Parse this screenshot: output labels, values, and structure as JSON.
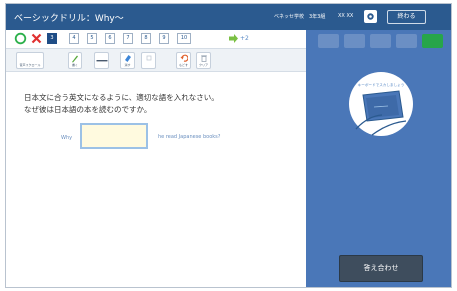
{
  "header": {
    "title": "ベーシックドリル：Why〜",
    "school": "ベネッセ学校",
    "class_info": "3年3組",
    "user": "XX XX",
    "exit_label": "終わる"
  },
  "question_nav": {
    "numbers": [
      "3",
      "4",
      "5",
      "6",
      "7",
      "8",
      "9",
      "10"
    ],
    "active": "3",
    "more_label": "+2"
  },
  "toolbar": {
    "tools": [
      {
        "label": "音声スクロール"
      },
      {
        "label": "書く"
      },
      {
        "label": ""
      },
      {
        "label": "消す"
      },
      {
        "label": ""
      },
      {
        "label": "もどす"
      },
      {
        "label": "クリア"
      }
    ]
  },
  "question": {
    "line1": "日本文に合う英文になるように、適切な語を入れなさい。",
    "line2": "なぜ彼は日本語の本を読むのですか。",
    "before": "Why",
    "after": "he read Japanese books?",
    "answer_value": ""
  },
  "right_panel": {
    "tabs": [
      "",
      "",
      "",
      "",
      ""
    ],
    "hint_text": "キーボードでスカしましょう",
    "submit_label": "答え合わせ"
  },
  "colors": {
    "topbar": "#2b5a8f",
    "panel": "#4a77b8",
    "active_tab": "#27a54a",
    "submit": "#3e4d5d",
    "input_bg": "#fffadf"
  }
}
